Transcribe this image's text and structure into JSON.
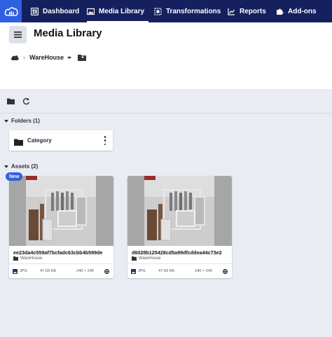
{
  "nav": {
    "items": [
      {
        "label": "Dashboard",
        "icon": "dashboard-icon"
      },
      {
        "label": "Media Library",
        "icon": "media-library-icon",
        "active": true
      },
      {
        "label": "Transformations",
        "icon": "transformations-icon"
      },
      {
        "label": "Reports",
        "icon": "reports-icon"
      },
      {
        "label": "Add-ons",
        "icon": "puzzle-icon"
      }
    ],
    "bg_color": "#14215e",
    "logo_color": "#2f60e0"
  },
  "header": {
    "title": "Media Library",
    "breadcrumb": {
      "root_icon": "cloud-icon",
      "current": "WareHouse"
    }
  },
  "sections": {
    "folders_label": "Folders (1)",
    "assets_label": "Assets (2)"
  },
  "folders": [
    {
      "name": "Category"
    }
  ],
  "assets": [
    {
      "badge": "New",
      "name": "ee23da4c559af7bcfadc63cbb4b599de",
      "folder": "WareHouse",
      "format": "JPG",
      "size": "47.69 KB",
      "dimensions": "240 × 240"
    },
    {
      "name": "d6028b125428cd5a99dfcddea44c73e2",
      "folder": "WareHouse",
      "format": "JPG",
      "size": "47.69 KB",
      "dimensions": "240 × 240"
    }
  ]
}
